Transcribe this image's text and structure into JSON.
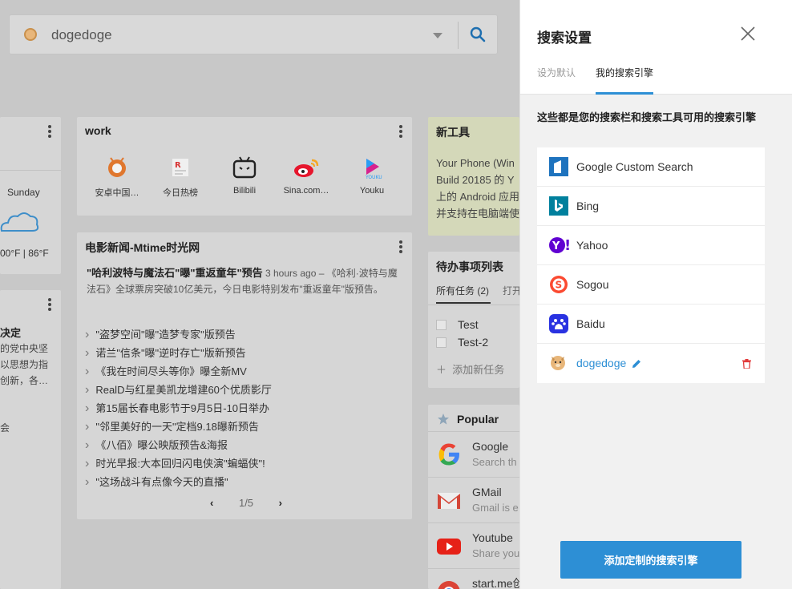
{
  "search": {
    "engine_name": "dogedoge"
  },
  "weather": {
    "day": "Sunday",
    "temps": "00°F |   86°F"
  },
  "news_partial": {
    "title": "决定",
    "lines": [
      "的党中央坚",
      "以思想为指",
      "创新，各…",
      "",
      "会"
    ]
  },
  "work": {
    "title": "work",
    "items": [
      {
        "label": "安卓中国…",
        "icon": "anzhuo-icon"
      },
      {
        "label": "今日热榜",
        "icon": "jinri-rebang-icon"
      },
      {
        "label": "Bilibili",
        "icon": "bilibili-icon"
      },
      {
        "label": "Sina.com…",
        "icon": "weibo-icon"
      },
      {
        "label": "Youku",
        "icon": "youku-icon"
      }
    ]
  },
  "mtime": {
    "title": "电影新闻-Mtime时光网",
    "headline": "\"哈利波特与魔法石\"曝\"重返童年\"预告",
    "time": "3 hours ago",
    "summary": "– 《哈利·波特与魔法石》全球票房突破10亿美元，今日电影特别发布\"重返童年\"版预告。",
    "items": [
      "\"盗梦空间\"曝\"造梦专家\"版预告",
      "诺兰\"信条\"曝\"逆时存亡\"版新预告",
      "《我在时间尽头等你》曝全新MV",
      "RealD与红星美凯龙增建60个优质影厅",
      "第15届长春电影节于9月5日-10日举办",
      "\"邻里美好的一天\"定档9.18曝新预告",
      "《八佰》曝公映版预告&海报",
      "时光早报:大本回归闪电侠演\"蝙蝠侠\"!",
      "\"这场战斗有点像今天的直播\""
    ],
    "pager": "1/5"
  },
  "tools": {
    "title": "新工具",
    "lines": [
      "Your Phone (Win",
      "Build 20185 的 Y",
      "上的 Android 应用",
      "并支持在电脑端使"
    ]
  },
  "todo": {
    "title": "待办事项列表",
    "tab_all": "所有任务 (2)",
    "tab_open": "打开",
    "items": [
      "Test",
      "Test-2"
    ],
    "add": "添加新任务"
  },
  "popular": {
    "title": "Popular",
    "items": [
      {
        "name": "Google",
        "sub": "Search th",
        "icon": "google-icon"
      },
      {
        "name": "GMail",
        "sub": "Gmail is e",
        "icon": "gmail-icon"
      },
      {
        "name": "Youtube",
        "sub": "Share you",
        "icon": "youtube-icon"
      },
      {
        "name": "start.me创",
        "sub": "",
        "icon": "chrome-icon"
      }
    ]
  },
  "panel": {
    "title": "搜索设置",
    "tab_default": "设为默认",
    "tab_mine": "我的搜索引擎",
    "description": "这些都是您的搜索栏和搜索工具可用的搜索引擎",
    "engines": [
      {
        "name": "Google Custom Search",
        "icon": "google-custom-search-icon",
        "color": "#1e73be"
      },
      {
        "name": "Bing",
        "icon": "bing-icon",
        "color": "#00809d"
      },
      {
        "name": "Yahoo",
        "icon": "yahoo-icon",
        "color": "#6001d2"
      },
      {
        "name": "Sogou",
        "icon": "sogou-icon",
        "color": "#fb4a31"
      },
      {
        "name": "Baidu",
        "icon": "baidu-icon",
        "color": "#2932e1"
      },
      {
        "name": "dogedoge",
        "icon": "dogedoge-icon",
        "color": "#2d8fd5"
      }
    ],
    "add_button": "添加定制的搜索引擎"
  },
  "colors": {
    "accent": "#2d8fd5",
    "delete": "#e23b3b"
  }
}
